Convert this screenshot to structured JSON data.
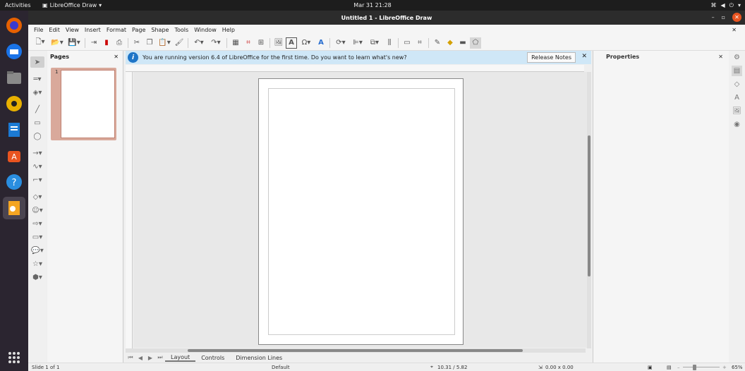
{
  "topbar": {
    "activities": "Activities",
    "app_name": "LibreOffice Draw",
    "clock": "Mar 31  21:28"
  },
  "window": {
    "title": "Untitled 1 - LibreOffice Draw"
  },
  "menu": [
    "File",
    "Edit",
    "View",
    "Insert",
    "Format",
    "Page",
    "Shape",
    "Tools",
    "Window",
    "Help"
  ],
  "pages_panel": {
    "title": "Pages",
    "page_number": "1"
  },
  "infobar": {
    "message": "You are running version 6.4 of LibreOffice for the first time. Do you want to learn what's new?",
    "button": "Release Notes"
  },
  "sidebar": {
    "title": "Properties"
  },
  "tabs": [
    "Layout",
    "Controls",
    "Dimension Lines"
  ],
  "status": {
    "slide": "Slide 1 of 1",
    "master": "Default",
    "position": "10.31 / 5.82",
    "size": "0.00 x 0.00",
    "zoom": "65%"
  },
  "colors": {
    "accent": "#e95420",
    "info_bg": "#cfe7f7",
    "page_thumb": "#d9a99b"
  }
}
